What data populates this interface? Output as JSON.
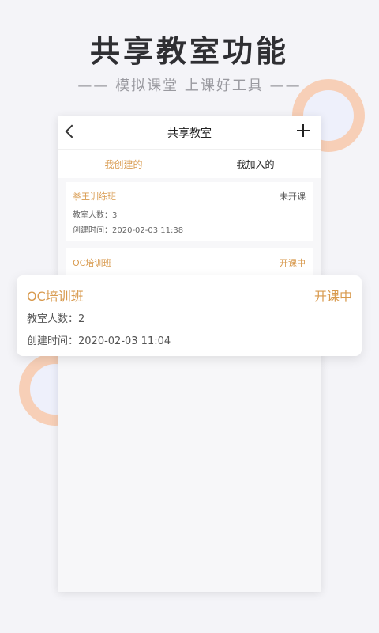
{
  "header": {
    "headline": "共享教室功能",
    "tagline": "—— 模拟课堂 上课好工具 ——"
  },
  "app": {
    "title": "共享教室",
    "tabs": [
      {
        "label": "我创建的",
        "active": true
      },
      {
        "label": "我加入的",
        "active": false
      }
    ],
    "classrooms": [
      {
        "name": "拳王训练班",
        "status": "未开课",
        "count_line": "教室人数：3",
        "created_line": "创建时间：2020-02-03 11:38"
      },
      {
        "name": "OC培训班",
        "status": "开课中"
      }
    ]
  },
  "popup": {
    "name": "OC培训班",
    "status": "开课中",
    "count_line": "教室人数：2",
    "created_line": "创建时间：2020-02-03 11:04"
  },
  "colors": {
    "accent": "#d89a4e",
    "ring": "#f7cfb7",
    "background": "#f4f4f8"
  },
  "icons": [
    "back-icon",
    "plus-icon"
  ]
}
